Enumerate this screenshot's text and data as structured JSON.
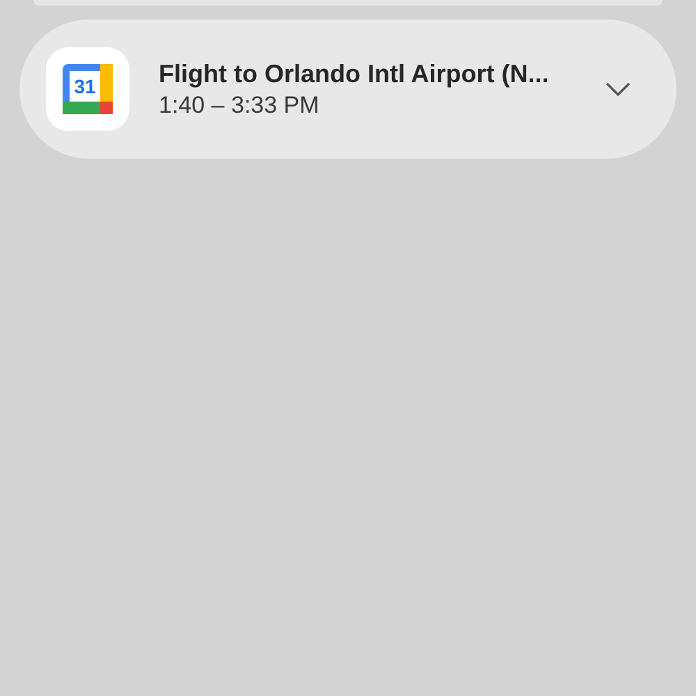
{
  "notifications": [
    {
      "app_icon_text": "31",
      "title": "Flight to Orlando Intl Airport (N...",
      "time": "1:40 – 3:33 PM",
      "expanded": false
    }
  ]
}
